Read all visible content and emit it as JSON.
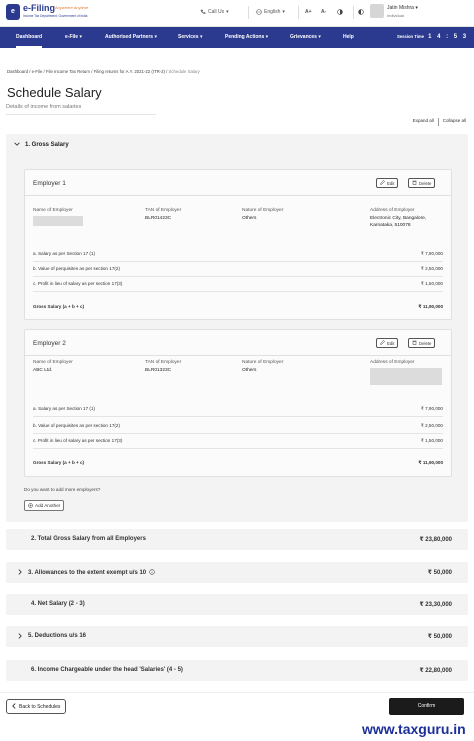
{
  "header": {
    "logo_mark": "e",
    "logo_title": "e-Filing",
    "logo_tagline": "Anywhere Anytime",
    "logo_subtitle": "Income Tax Department, Government of India",
    "call_us": "Call Us",
    "language": "English",
    "font_plus": "A+",
    "font_minus": "A-",
    "user_name": "Jatin Mishra",
    "user_role": "Individual"
  },
  "nav": {
    "items": [
      {
        "label": "Dashboard",
        "active": true
      },
      {
        "label": "e-File ▾"
      },
      {
        "label": "Authorised Partners ▾"
      },
      {
        "label": "Services ▾"
      },
      {
        "label": "Pending Actions ▾"
      },
      {
        "label": "Grievances ▾"
      },
      {
        "label": "Help"
      }
    ],
    "session_label": "Session Time",
    "session_time": "1 4 : 5 3"
  },
  "breadcrumb": {
    "path": "Dashboard / e-File / File Income Tax Return / Filing returns for A.Y. 2021-22 (ITR-2) /",
    "current": "Schedule Salary"
  },
  "page": {
    "title": "Schedule Salary",
    "subtitle": "Details of income from salaries",
    "expand_all": "Expand all",
    "collapse_all": "Collapse all"
  },
  "gross_salary_section": {
    "title": "1. Gross Salary",
    "edit_label": "Edit",
    "delete_label": "Delete",
    "labels": {
      "name": "Name of Employer",
      "tan": "TAN of Employer",
      "nature": "Nature of Employer",
      "address": "Address of Employer",
      "salary": "a. Salary as per Section 17 (1)",
      "perquisites": "b. Value of perquisites as per section 17(2)",
      "profit": "c. Profit in lieu of salary as per section 17(3)",
      "gross": "Gross Salary (a + b + c)"
    },
    "employers": [
      {
        "title": "Employer 1",
        "name": "",
        "tan": "BLR01423C",
        "nature": "Others",
        "address": "Electronic City, Bangalore, Karnataka, 510078",
        "salary": "₹ 7,90,000",
        "perquisites": "₹ 2,50,000",
        "profit": "₹ 1,50,000",
        "gross": "₹ 11,90,000"
      },
      {
        "title": "Employer 2",
        "name": "ABC Ltd.",
        "tan": "BLR01323C",
        "nature": "Others",
        "address": "",
        "salary": "₹ 7,90,000",
        "perquisites": "₹ 2,50,000",
        "profit": "₹ 1,50,000",
        "gross": "₹ 11,90,000"
      }
    ],
    "more_question": "Do you want to add more employers?",
    "add_another": "Add Another"
  },
  "summary_rows": [
    {
      "label": "2. Total Gross Salary from all Employers",
      "value": "₹ 23,80,000",
      "expandable": false
    },
    {
      "label": "3. Allowances to the extent exempt u/s 10",
      "value": "₹ 50,000",
      "expandable": true,
      "info": true
    },
    {
      "label": "4. Net Salary (2 - 3)",
      "value": "₹ 23,30,000",
      "expandable": false
    },
    {
      "label": "5. Deductions u/s 16",
      "value": "₹ 50,000",
      "expandable": true
    },
    {
      "label": "6. Income Chargeable under the head 'Salaries' (4 - 5)",
      "value": "₹ 22,80,000",
      "expandable": false
    }
  ],
  "footer": {
    "back_label": "Back to Schedules",
    "confirm_label": "Confirm",
    "watermark": "www.taxguru.in"
  },
  "colors": {
    "nav_bg": "#2b3a8f",
    "confirm_bg": "#1b1b1b",
    "section_bg": "#f3f3f3",
    "watermark": "#1c2f9a"
  }
}
